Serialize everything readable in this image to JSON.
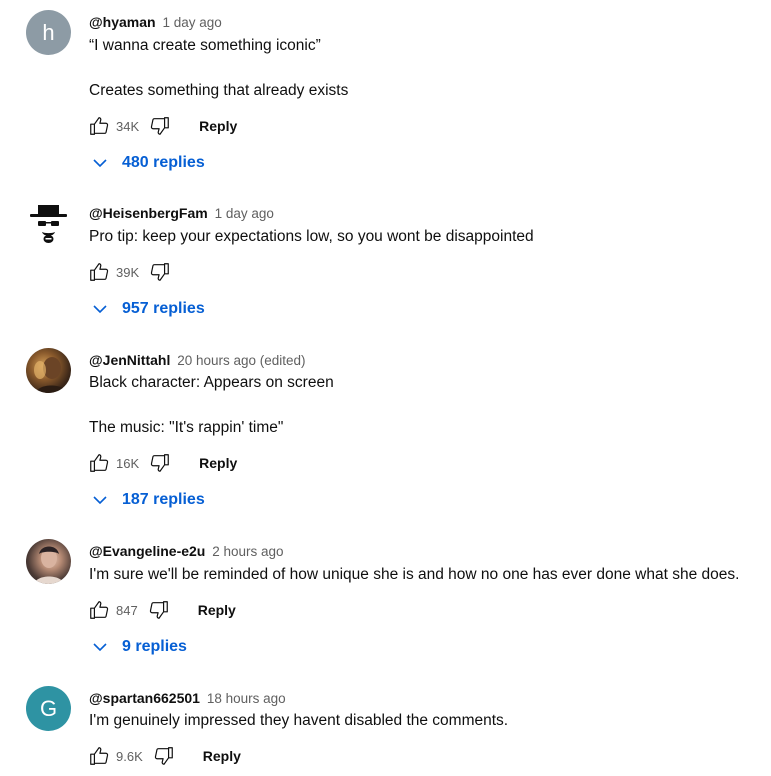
{
  "comments": [
    {
      "avatar_letter": "h",
      "avatar_color": "#8d9ba5",
      "author": "@hyaman",
      "time": "1 day ago",
      "lines": [
        "“I wanna create something iconic”",
        "Creates something that already exists"
      ],
      "likes": "34K",
      "reply_label": "Reply",
      "replies_label": "480 replies"
    },
    {
      "avatar_icon": "heisenberg-icon",
      "author": "@HeisenbergFam",
      "time": "1 day ago",
      "lines": [
        "Pro tip: keep your expectations low, so you wont be disappointed"
      ],
      "likes": "39K",
      "replies_label": "957 replies"
    },
    {
      "avatar_icon": "user-photo",
      "author": "@JenNittahl",
      "time": "20 hours ago (edited)",
      "lines": [
        "Black character: Appears on screen",
        "The music: \"It's rappin' time\""
      ],
      "likes": "16K",
      "reply_label": "Reply",
      "replies_label": "187 replies"
    },
    {
      "avatar_icon": "user-photo",
      "author": "@Evangeline-e2u",
      "time": "2 hours ago",
      "lines": [
        "I'm sure we'll be reminded of how unique she is and how no one has ever done what she does."
      ],
      "likes": "847",
      "reply_label": "Reply",
      "replies_label": "9 replies"
    },
    {
      "avatar_letter": "G",
      "avatar_color": "#2e93a3",
      "author": "@spartan662501",
      "time": "18 hours ago",
      "lines": [
        "I'm genuinely impressed they havent disabled the comments."
      ],
      "likes": "9.6K",
      "reply_label": "Reply"
    }
  ],
  "colors": {
    "link_blue": "#065fd4",
    "muted_text": "#606060"
  }
}
